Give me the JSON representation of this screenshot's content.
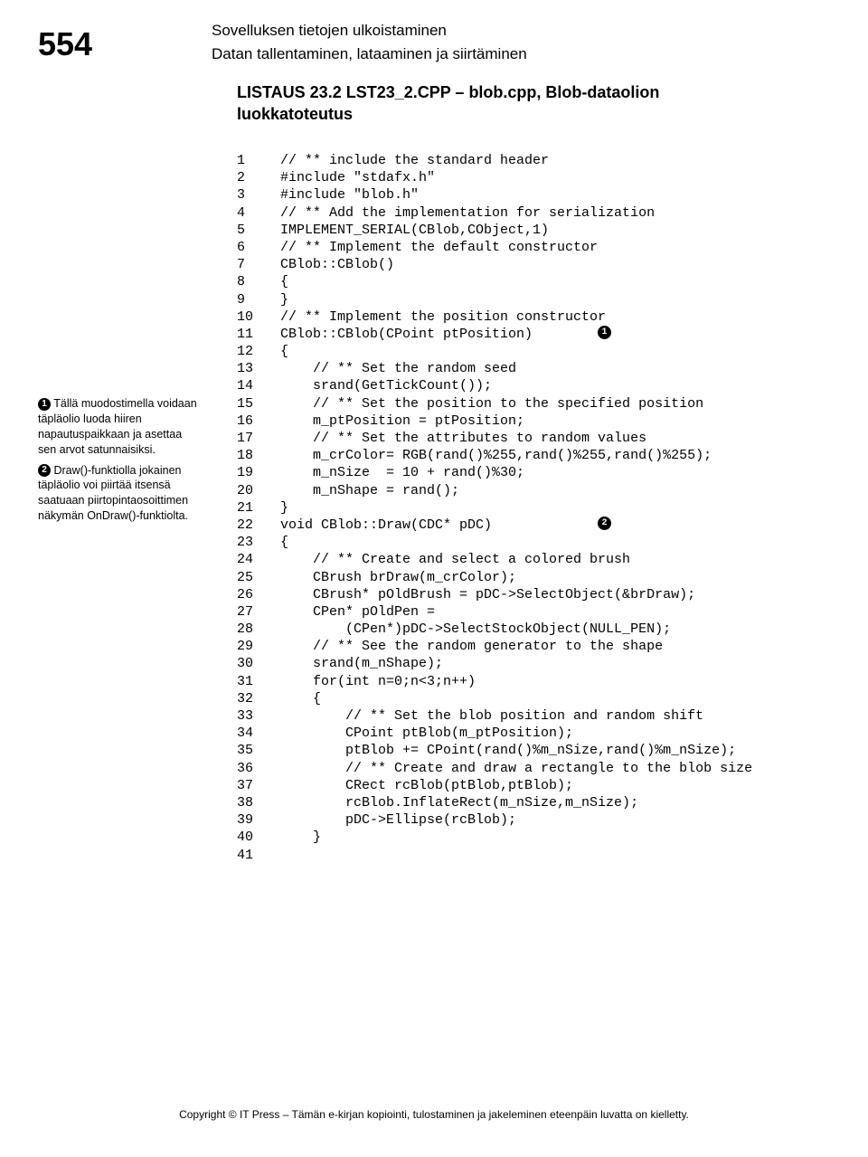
{
  "page_number": "554",
  "section_title": "Sovelluksen tietojen ulkoistaminen",
  "subsection_title": "Datan tallentaminen, lataaminen ja siirtäminen",
  "listing_heading_l1": "LISTAUS 23.2  LST23_2.CPP – blob.cpp, Blob-dataolion",
  "listing_heading_l2": "luokkatoteutus",
  "side_note_1_pre": "Tällä muodostimella voidaan täpläolio luoda hiiren napautuspaikkaan ja asettaa sen arvot satunnaisiksi.",
  "side_note_2_pre": "Draw()-funktiolla jokainen täpläolio voi piirtää itsensä saatuaan piirtopintaosoittimen näkymän OnDraw()-funktiolta.",
  "code": [
    {
      "n": "1",
      "t": "// ** include the standard header"
    },
    {
      "n": "2",
      "t": "#include \"stdafx.h\""
    },
    {
      "n": "3",
      "t": "#include \"blob.h\""
    },
    {
      "n": "",
      "t": ""
    },
    {
      "n": "4",
      "t": "// ** Add the implementation for serialization"
    },
    {
      "n": "5",
      "t": "IMPLEMENT_SERIAL(CBlob,CObject,1)"
    },
    {
      "n": "",
      "t": ""
    },
    {
      "n": "6",
      "t": "// ** Implement the default constructor"
    },
    {
      "n": "7",
      "t": "CBlob::CBlob()"
    },
    {
      "n": "8",
      "t": "{"
    },
    {
      "n": "9",
      "t": "}"
    },
    {
      "n": "",
      "t": ""
    },
    {
      "n": "10",
      "t": "// ** Implement the position constructor"
    },
    {
      "n": "11",
      "t": "CBlob::CBlob(CPoint ptPosition)        ",
      "c": "1"
    },
    {
      "n": "12",
      "t": "{"
    },
    {
      "n": "13",
      "t": "    // ** Set the random seed"
    },
    {
      "n": "14",
      "t": "    srand(GetTickCount());"
    },
    {
      "n": "",
      "t": ""
    },
    {
      "n": "15",
      "t": "    // ** Set the position to the specified position"
    },
    {
      "n": "16",
      "t": "    m_ptPosition = ptPosition;"
    },
    {
      "n": "",
      "t": ""
    },
    {
      "n": "17",
      "t": "    // ** Set the attributes to random values"
    },
    {
      "n": "18",
      "t": "    m_crColor= RGB(rand()%255,rand()%255,rand()%255);"
    },
    {
      "n": "19",
      "t": "    m_nSize  = 10 + rand()%30;"
    },
    {
      "n": "20",
      "t": "    m_nShape = rand();"
    },
    {
      "n": "21",
      "t": "}"
    },
    {
      "n": "",
      "t": ""
    },
    {
      "n": "22",
      "t": "void CBlob::Draw(CDC* pDC)             ",
      "c": "2"
    },
    {
      "n": "23",
      "t": "{"
    },
    {
      "n": "24",
      "t": "    // ** Create and select a colored brush"
    },
    {
      "n": "25",
      "t": "    CBrush brDraw(m_crColor);"
    },
    {
      "n": "26",
      "t": "    CBrush* pOldBrush = pDC->SelectObject(&brDraw);"
    },
    {
      "n": "27",
      "t": "    CPen* pOldPen ="
    },
    {
      "n": "28",
      "t": "        (CPen*)pDC->SelectStockObject(NULL_PEN);"
    },
    {
      "n": "",
      "t": ""
    },
    {
      "n": "29",
      "t": "    // ** See the random generator to the shape"
    },
    {
      "n": "30",
      "t": "    srand(m_nShape);"
    },
    {
      "n": "31",
      "t": "    for(int n=0;n<3;n++)"
    },
    {
      "n": "32",
      "t": "    {"
    },
    {
      "n": "33",
      "t": "        // ** Set the blob position and random shift"
    },
    {
      "n": "34",
      "t": "        CPoint ptBlob(m_ptPosition);"
    },
    {
      "n": "35",
      "t": "        ptBlob += CPoint(rand()%m_nSize,rand()%m_nSize);"
    },
    {
      "n": "",
      "t": ""
    },
    {
      "n": "36",
      "t": "        // ** Create and draw a rectangle to the blob size"
    },
    {
      "n": "37",
      "t": "        CRect rcBlob(ptBlob,ptBlob);"
    },
    {
      "n": "38",
      "t": "        rcBlob.InflateRect(m_nSize,m_nSize);"
    },
    {
      "n": "39",
      "t": "        pDC->Ellipse(rcBlob);"
    },
    {
      "n": "40",
      "t": "    }"
    },
    {
      "n": "41",
      "t": ""
    }
  ],
  "footer": "Copyright © IT Press – Tämän e-kirjan kopiointi, tulostaminen ja jakeleminen eteenpäin luvatta on kielletty."
}
